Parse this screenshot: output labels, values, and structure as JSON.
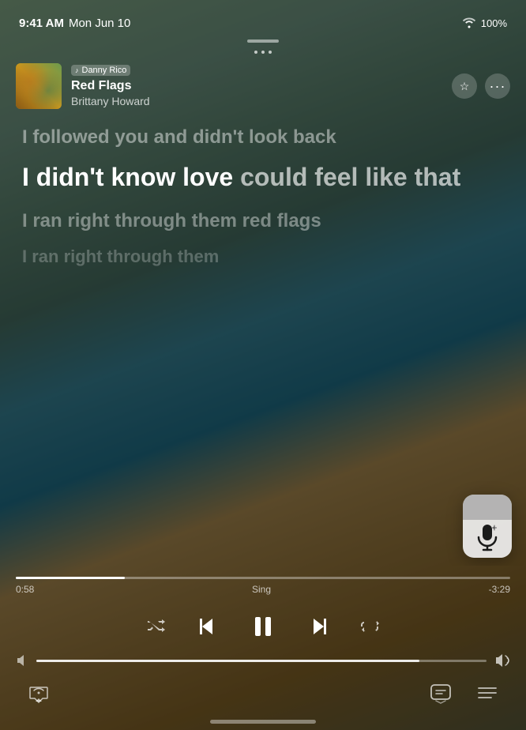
{
  "statusBar": {
    "time": "9:41 AM",
    "date": "Mon Jun 10",
    "wifi": "100%",
    "battery": "100%"
  },
  "nowPlaying": {
    "dj": "Danny Rico",
    "title": "Red Flags",
    "artist": "Brittany Howard"
  },
  "lyrics": {
    "past": "I followed you and didn't look back",
    "current_bold": "I didn't know love ",
    "current_dim": "could feel like that",
    "future1": "I ran right through them red flags",
    "future2": "I ran right through them"
  },
  "progress": {
    "elapsed": "0:58",
    "label": "Sing",
    "remaining": "-3:29",
    "percent": 22
  },
  "volume": {
    "percent": 85
  },
  "controls": {
    "shuffle": "⇄",
    "prev": "⏮",
    "pause": "⏸",
    "next": "⏭",
    "repeat": "↻"
  },
  "bottomBar": {
    "airplay": "airplay",
    "lyrics": "lyrics",
    "queue": "queue"
  },
  "icons": {
    "star": "☆",
    "more": "•••",
    "mic": "🎤",
    "volLow": "🔈",
    "volHigh": "🔊",
    "airplay": "⊡",
    "message": "💬",
    "list": "☰"
  }
}
